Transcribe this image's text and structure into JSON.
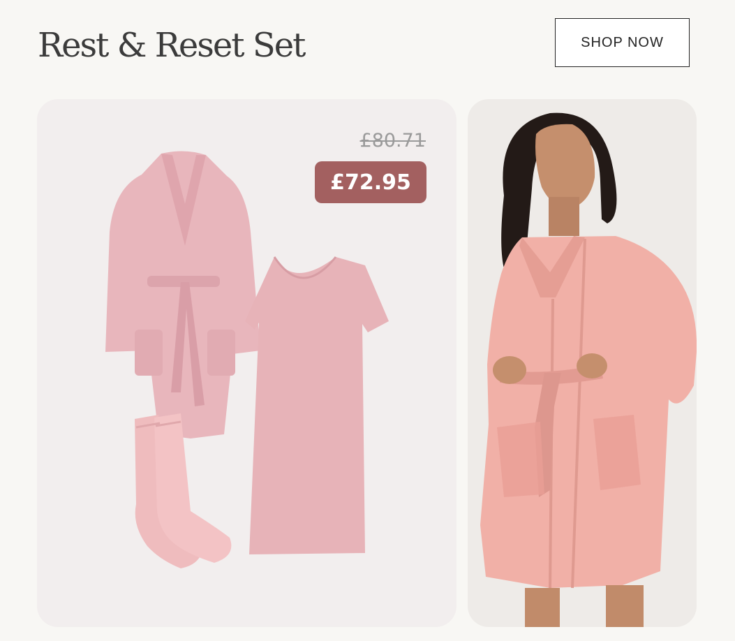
{
  "header": {
    "title": "Rest & Reset Set",
    "cta_label": "SHOP NOW"
  },
  "pricing": {
    "original_price": "£80.71",
    "sale_price": "£72.95"
  },
  "products": {
    "items": [
      "robe",
      "nightdress",
      "socks"
    ]
  },
  "colors": {
    "badge": "#a36060",
    "product_pink": "#e8b5bb",
    "model_robe": "#f1b1a8"
  }
}
